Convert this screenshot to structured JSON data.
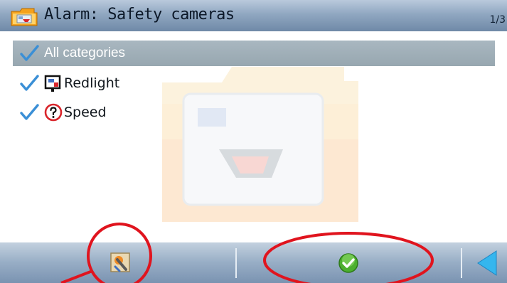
{
  "header": {
    "title": "Alarm: Safety cameras",
    "page_indicator": "1/3",
    "icon": "folder-camera-icon"
  },
  "categories": [
    {
      "label": "All categories",
      "checked": true,
      "selected": true,
      "icon": null
    },
    {
      "label": "Redlight",
      "checked": true,
      "selected": false,
      "icon": "redlight-camera-icon"
    },
    {
      "label": "Speed",
      "checked": true,
      "selected": false,
      "icon": "speed-camera-icon"
    }
  ],
  "toolbar": {
    "buttons": [
      {
        "icon": "edit-settings-icon"
      },
      {
        "icon": "confirm-check-icon"
      },
      {
        "icon": "back-arrow-icon"
      }
    ]
  },
  "colors": {
    "titlebar": "#90a7c1",
    "selected_row": "#a9b7c0",
    "checkmark": "#3a8fd6",
    "confirm": "#4caf2f",
    "annotation": "#e0141e"
  }
}
